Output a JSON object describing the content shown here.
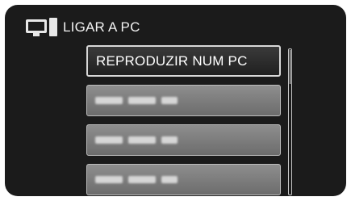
{
  "header": {
    "icon": "pc-connection-icon",
    "title": "LIGAR A PC"
  },
  "menu": {
    "items": [
      {
        "label": "REPRODUZIR NUM PC",
        "selected": true,
        "obscured": false
      },
      {
        "label": "",
        "selected": false,
        "obscured": true
      },
      {
        "label": "",
        "selected": false,
        "obscured": true
      },
      {
        "label": "",
        "selected": false,
        "obscured": true
      }
    ]
  },
  "scrollbar": {
    "position_fraction": 0.0
  }
}
